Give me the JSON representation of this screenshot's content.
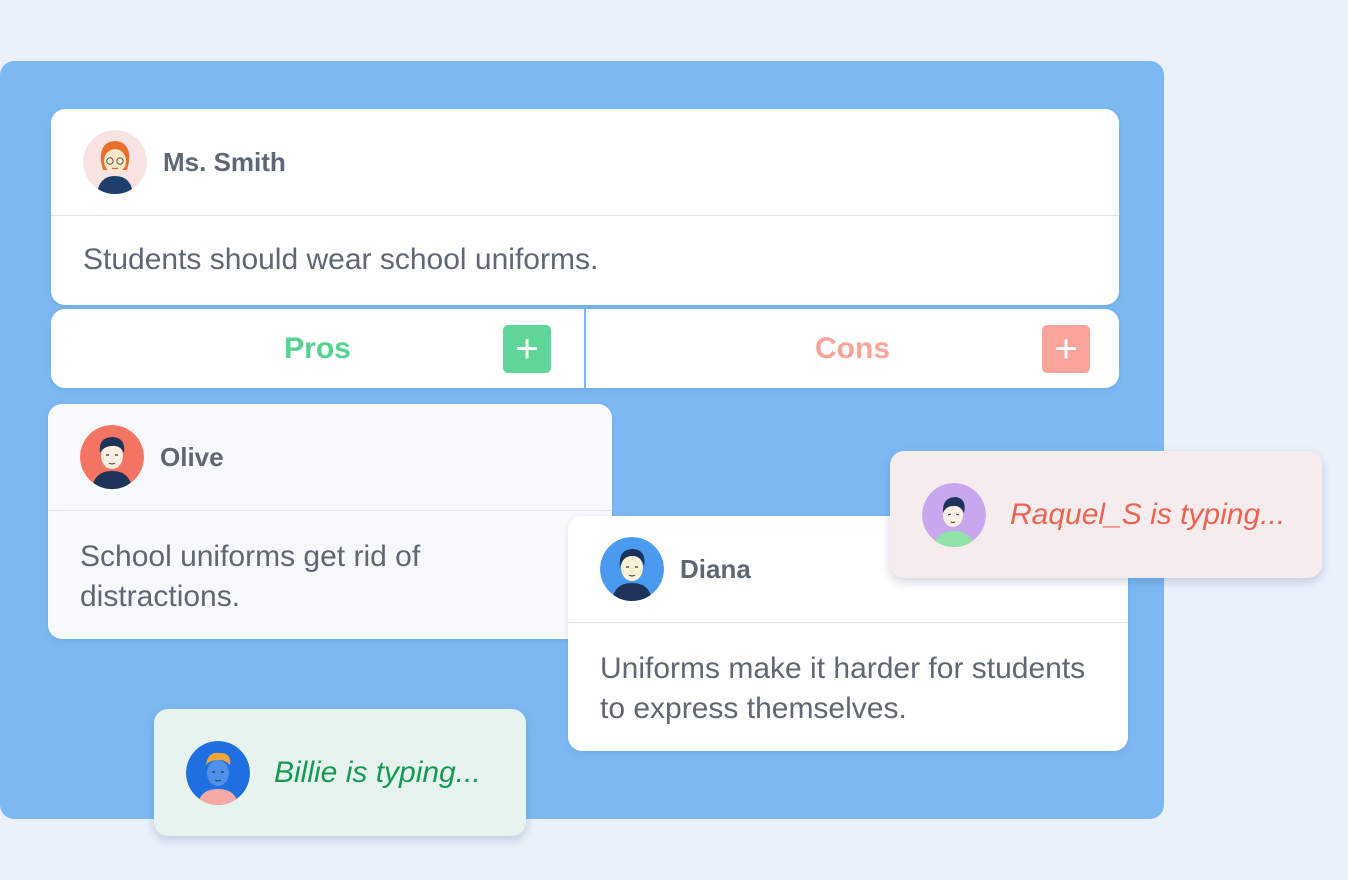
{
  "topic": {
    "author": "Ms. Smith",
    "statement": "Students should wear school uniforms."
  },
  "columns": {
    "pros_label": "Pros",
    "cons_label": "Cons",
    "add_symbol": "+"
  },
  "posts": [
    {
      "author": "Olive",
      "text": "School uniforms get rid of distractions.",
      "column": "Pros"
    },
    {
      "author": "Diana",
      "text": "Uniforms make it harder for students to express themselves.",
      "column": "Cons"
    }
  ],
  "typing_indicators": [
    {
      "text": "Raquel_S is typing..."
    },
    {
      "text": "Billie is typing..."
    }
  ],
  "colors": {
    "board": "#7cb9f3",
    "pros": "#52d38e",
    "cons": "#f9a39b",
    "raquel_text": "#ec6451",
    "billie_text": "#159a54"
  }
}
